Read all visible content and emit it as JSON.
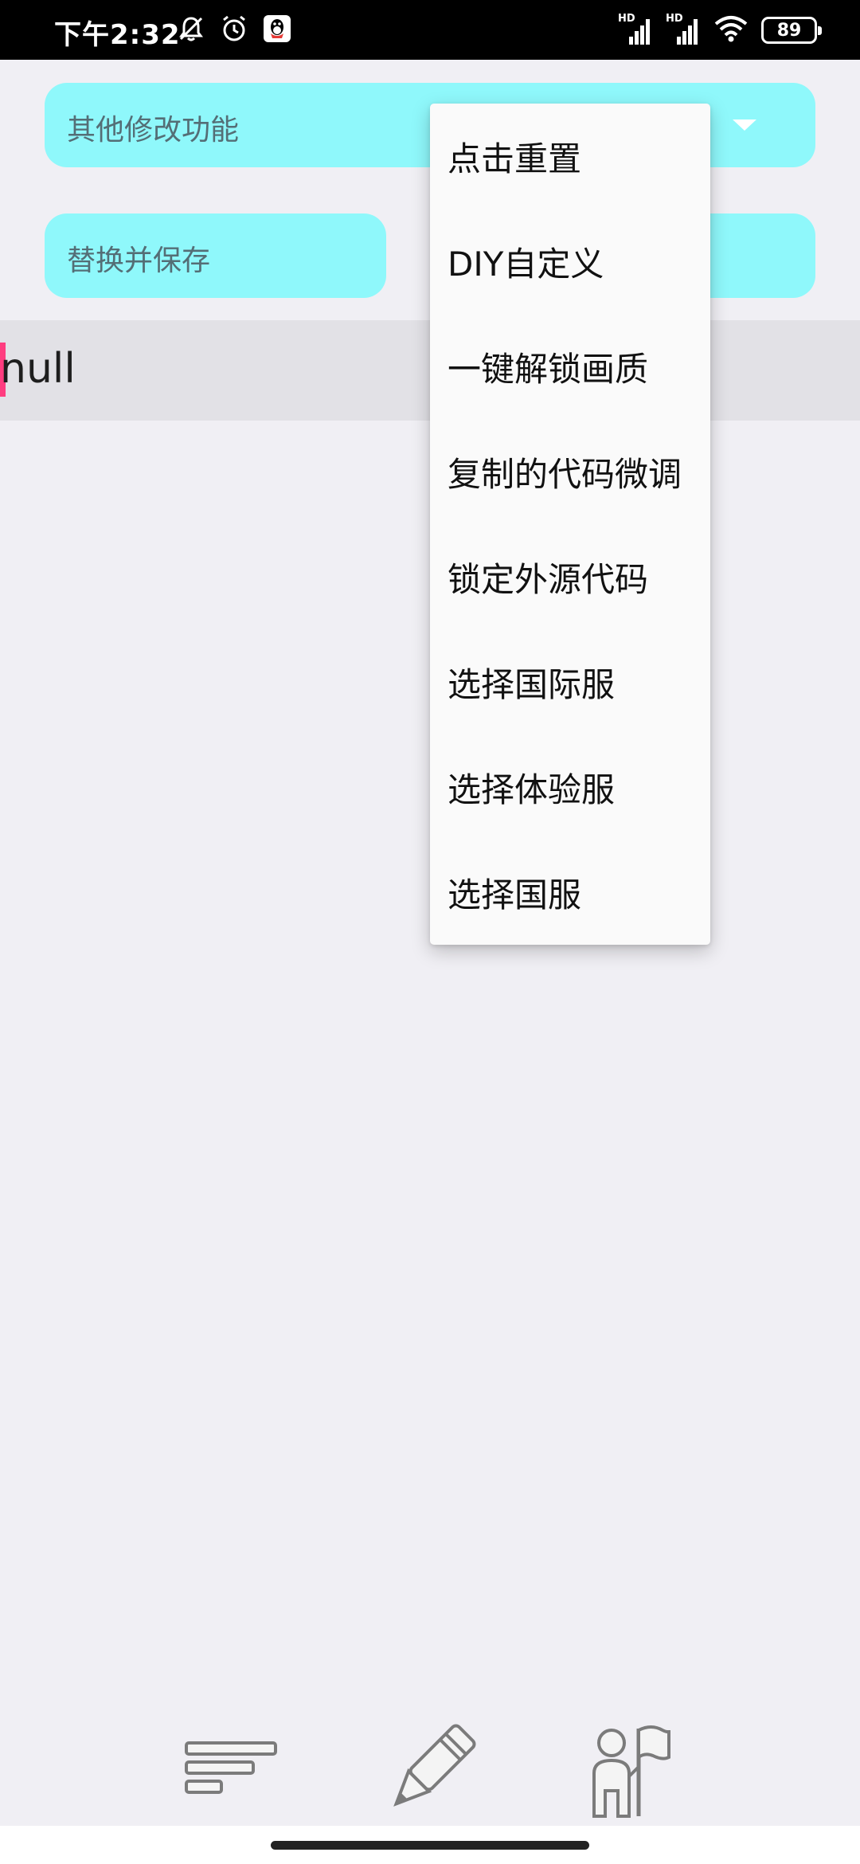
{
  "status_bar": {
    "time": "下午2:32",
    "left_icons": [
      "bell-off-icon",
      "alarm-icon",
      "qq-icon"
    ],
    "network_labels": [
      "HD",
      "HD"
    ],
    "battery_level": "89"
  },
  "dropdown_select": {
    "selected_label": "其他修改功能",
    "options": [
      "点击重置",
      "DIY自定义",
      "一键解锁画质",
      "复制的代码微调",
      "锁定外源代码",
      "选择国际服",
      "选择体验服",
      "选择国服"
    ]
  },
  "buttons": {
    "replace_save_label": "替换并保存"
  },
  "output": {
    "text": "null"
  },
  "bottom_nav": {
    "icons": [
      "list-icon",
      "pencil-icon",
      "person-flag-icon"
    ]
  },
  "colors": {
    "accent_cyan": "#8ff8fb",
    "cursor_pink": "#ff3d80",
    "background": "#f0eff4"
  }
}
